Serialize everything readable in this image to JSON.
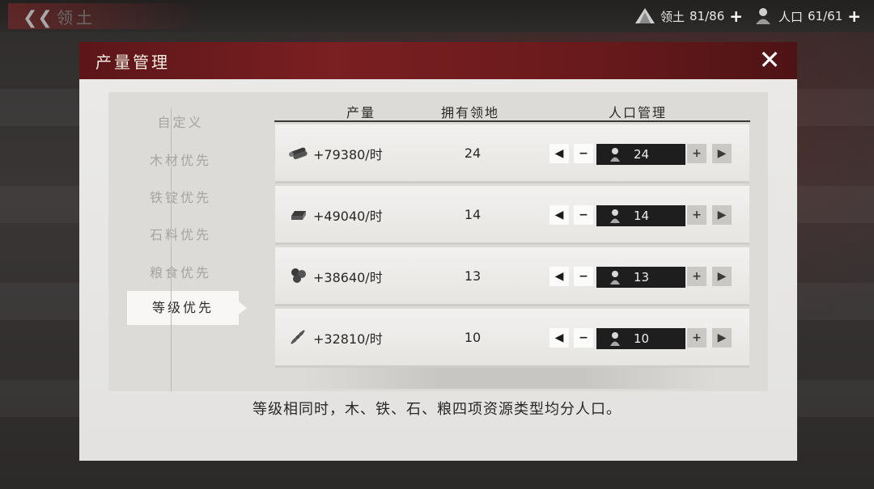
{
  "topbar": {
    "title": "领土",
    "territory_label": "领土",
    "territory_value": "81/86",
    "population_label": "人口",
    "population_value": "61/61",
    "plus": "+"
  },
  "dialog": {
    "title": "产量管理",
    "close_glyph": "✕"
  },
  "sidebar": {
    "items": [
      {
        "label": "自定义",
        "active": false
      },
      {
        "label": "木材优先",
        "active": false
      },
      {
        "label": "铁锭优先",
        "active": false
      },
      {
        "label": "石料优先",
        "active": false
      },
      {
        "label": "粮食优先",
        "active": false
      },
      {
        "label": "等级优先",
        "active": true
      }
    ]
  },
  "table": {
    "headers": {
      "production": "产量",
      "territory": "拥有领地",
      "population": "人口管理"
    },
    "rows": [
      {
        "resource_icon": "wood-icon",
        "production": "+79380/时",
        "territory": "24",
        "population": "24"
      },
      {
        "resource_icon": "iron-icon",
        "production": "+49040/时",
        "territory": "14",
        "population": "14"
      },
      {
        "resource_icon": "stone-icon",
        "production": "+38640/时",
        "territory": "13",
        "population": "13"
      },
      {
        "resource_icon": "grain-icon",
        "production": "+32810/时",
        "territory": "10",
        "population": "10"
      }
    ]
  },
  "controls": {
    "left_arrow": "◀",
    "minus": "−",
    "plus": "+",
    "right_arrow": "▶"
  },
  "note": "等级相同时，木、铁、石、粮四项资源类型均分人口。",
  "colors": {
    "header_red": "#7a1f22",
    "panel": "#e3e2e0",
    "pop_box": "#1e1e1f"
  }
}
